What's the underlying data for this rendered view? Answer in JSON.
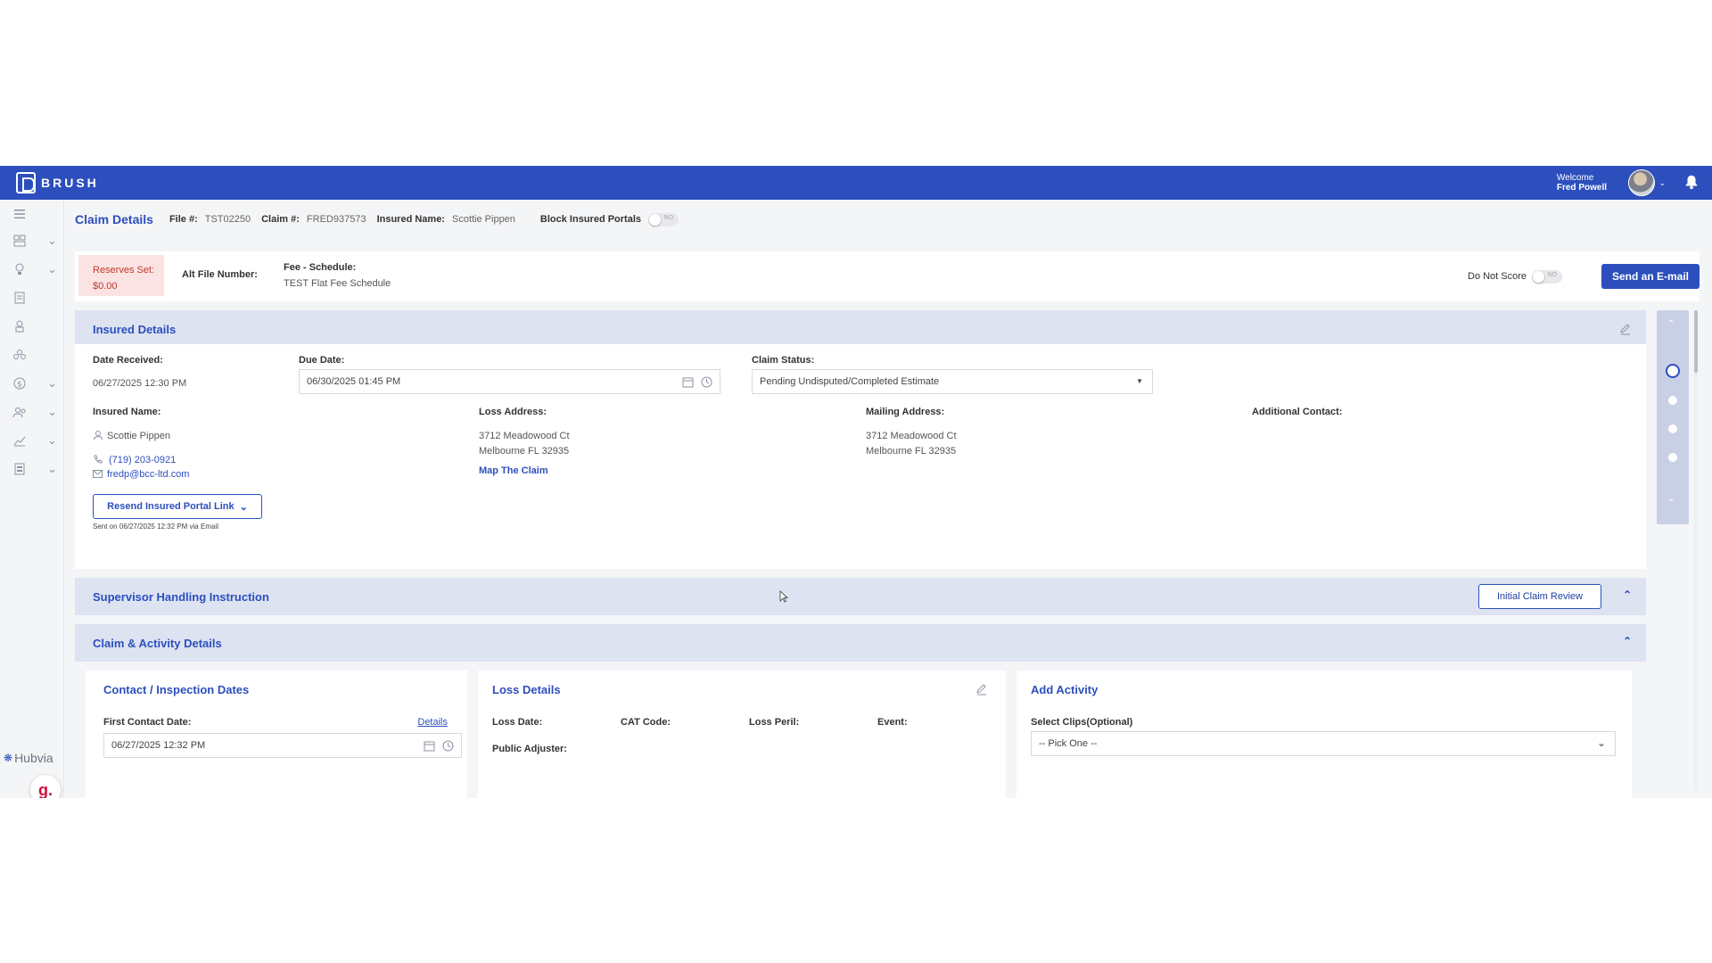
{
  "header": {
    "logo_text": "BRUSH",
    "welcome": "Welcome",
    "user_name": "Fred Powell"
  },
  "sidebar": {
    "items": [
      "dashboard-icon",
      "lightbulb-icon",
      "document-icon",
      "user-badge-icon",
      "group-icon",
      "dollar-icon",
      "users-icon",
      "chart-icon",
      "report-icon"
    ]
  },
  "claim_bar": {
    "title": "Claim Details",
    "file_label": "File #:",
    "file_value": "TST02250",
    "claim_label": "Claim #:",
    "claim_value": "FRED937573",
    "insured_label": "Insured Name:",
    "insured_value": "Scottie Pippen",
    "block_label": "Block Insured Portals",
    "block_toggle": "NO"
  },
  "info_bar": {
    "reserves_label": "Reserves Set:",
    "reserves_value": "$0.00",
    "alt_file_label": "Alt File Number:",
    "fee_label": "Fee - Schedule:",
    "fee_value": "TEST Flat Fee Schedule",
    "do_not_score_label": "Do Not Score",
    "do_not_score_toggle": "NO",
    "send_email": "Send an E-mail"
  },
  "insured_details": {
    "title": "Insured Details",
    "date_received_label": "Date Received:",
    "date_received": "06/27/2025 12:30 PM",
    "due_date_label": "Due Date:",
    "due_date": "06/30/2025 01:45 PM",
    "claim_status_label": "Claim Status:",
    "claim_status": "Pending Undisputed/Completed Estimate",
    "insured_name_label": "Insured Name:",
    "insured_name": "Scottie Pippen",
    "phone": "(719) 203-0921",
    "email": "fredp@bcc-ltd.com",
    "resend_button": "Resend Insured Portal Link",
    "sent_note": "Sent on 06/27/2025 12:32 PM via Email",
    "loss_address_label": "Loss Address:",
    "loss_address_line1": "3712 Meadowood Ct",
    "loss_address_line2": "Melbourne FL 32935",
    "map_link": "Map The Claim",
    "mailing_address_label": "Mailing Address:",
    "mailing_address_line1": "3712 Meadowood Ct",
    "mailing_address_line2": "Melbourne FL 32935",
    "additional_contact_label": "Additional Contact:"
  },
  "supervisor": {
    "title": "Supervisor Handling Instruction",
    "button": "Initial Claim Review"
  },
  "claim_activity": {
    "title": "Claim & Activity Details",
    "contact_card": {
      "title": "Contact / Inspection Dates",
      "first_contact_label": "First Contact Date:",
      "details_link": "Details",
      "first_contact_value": "06/27/2025 12:32 PM"
    },
    "loss_card": {
      "title": "Loss Details",
      "loss_date_label": "Loss Date:",
      "cat_code_label": "CAT Code:",
      "loss_peril_label": "Loss Peril:",
      "event_label": "Event:",
      "public_adjuster_label": "Public Adjuster:"
    },
    "activity_card": {
      "title": "Add Activity",
      "select_label": "Select Clips(Optional)",
      "select_value": "-- Pick One --"
    }
  },
  "footer": {
    "hubvia": "Hubvia",
    "g_badge": "g."
  },
  "colors": {
    "brand_blue": "#2c4fbd",
    "panel_header": "#dde3f1",
    "reserves_bg": "#fbe3e3"
  }
}
